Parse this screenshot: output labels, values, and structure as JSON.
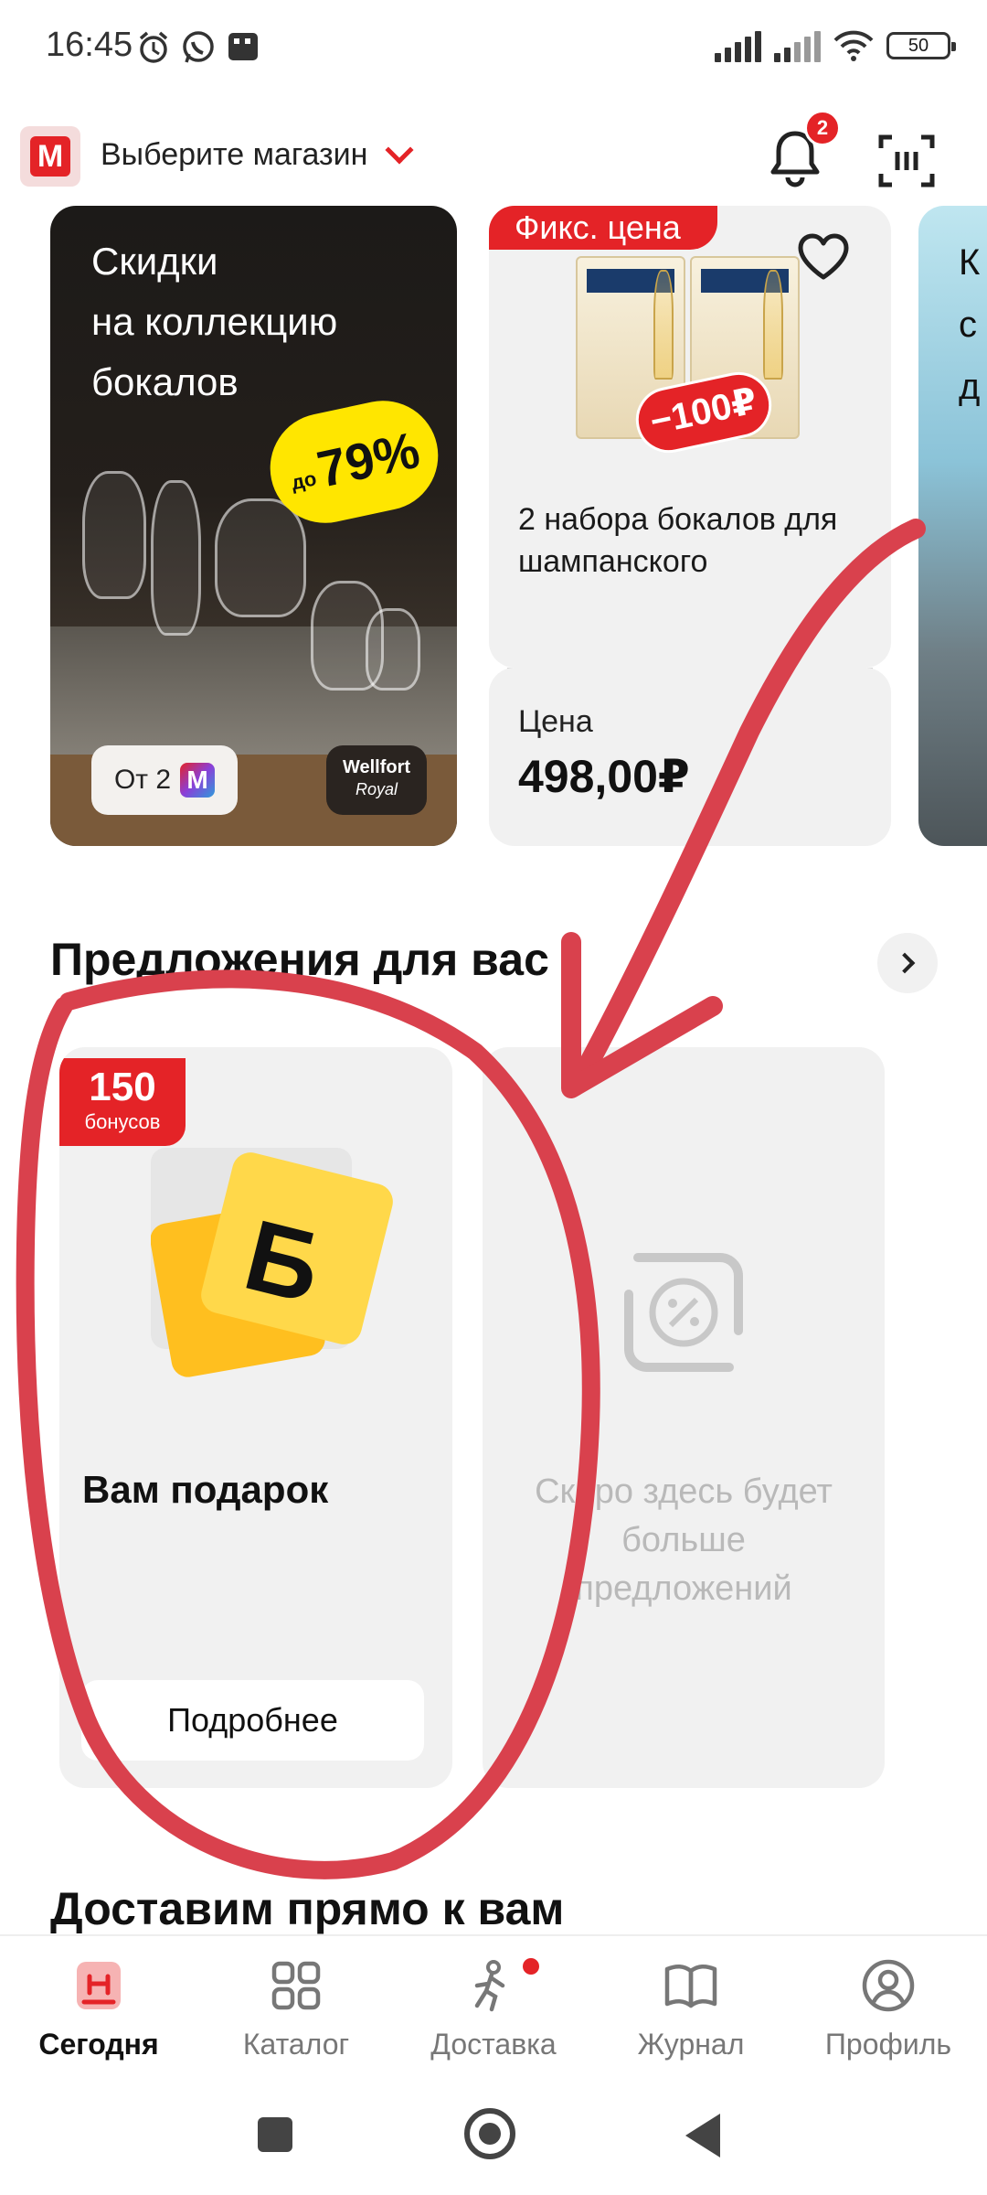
{
  "status_bar": {
    "time": "16:45",
    "battery": "50"
  },
  "header": {
    "store_select": "Выберите магазин",
    "notifications_count": "2"
  },
  "promo_cards": [
    {
      "title_lines": [
        "Скидки",
        "на коллекцию",
        "бокалов"
      ],
      "discount_prefix": "до",
      "discount": "79%",
      "from_chip": "От 2",
      "m_badge": "М",
      "brand": "Wellfort",
      "brand_sub": "Royal"
    },
    {
      "badge": "Фикс. цена",
      "sticker": "−100₽",
      "name": "2 набора бокалов для шампанского",
      "price_label": "Цена",
      "price": "498,00₽"
    },
    {
      "title_lines": [
        "К",
        "с",
        "д"
      ]
    }
  ],
  "offers": {
    "title": "Предложения для вас",
    "card": {
      "bonus_value": "150",
      "bonus_unit": "бонусов",
      "gift_letter": "Б",
      "title": "Вам подарок",
      "button": "Подробнее"
    },
    "placeholder_text": "Скоро здесь будет больше предложений"
  },
  "deliver": {
    "title": "Доставим прямо к вам"
  },
  "bottom_nav": [
    {
      "label": "Сегодня",
      "icon": "today-icon",
      "active": true
    },
    {
      "label": "Каталог",
      "icon": "catalog-icon",
      "active": false
    },
    {
      "label": "Доставка",
      "icon": "delivery-icon",
      "active": false
    },
    {
      "label": "Журнал",
      "icon": "journal-icon",
      "active": false
    },
    {
      "label": "Профиль",
      "icon": "profile-icon",
      "active": false
    }
  ],
  "colors": {
    "brand_red": "#e42327",
    "annotation_red": "#d9414d",
    "discount_yellow": "#ffe600"
  }
}
